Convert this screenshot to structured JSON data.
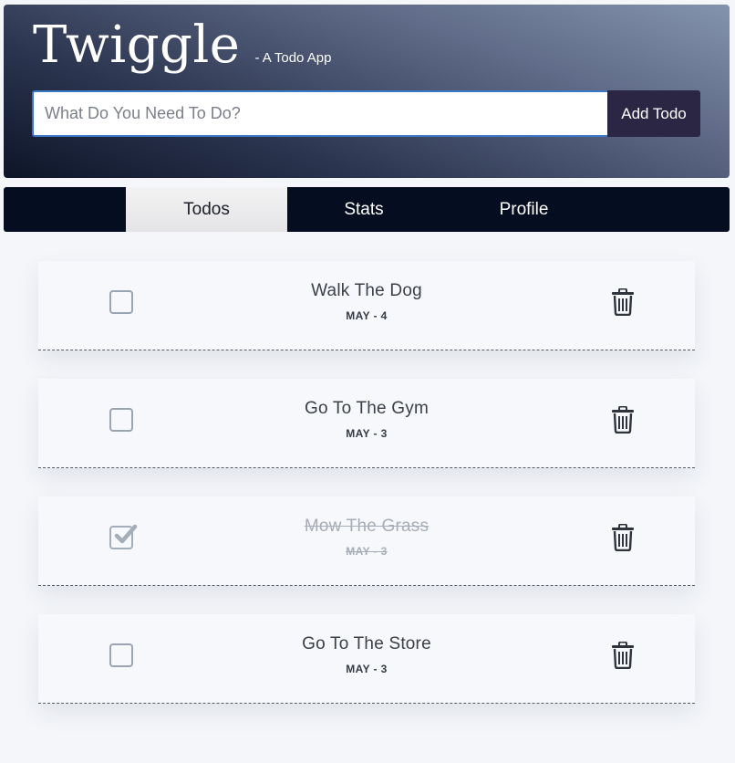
{
  "app": {
    "title": "Twiggle",
    "subtitle": "- A Todo App"
  },
  "add_form": {
    "input_placeholder": "What Do You Need To Do?",
    "input_value": "",
    "button_label": "Add Todo"
  },
  "tabs": [
    {
      "label": "Todos",
      "active": true
    },
    {
      "label": "Stats",
      "active": false
    },
    {
      "label": "Profile",
      "active": false
    }
  ],
  "todos": [
    {
      "title": "Walk The Dog",
      "date": "MAY - 4",
      "completed": false
    },
    {
      "title": "Go To The Gym",
      "date": "MAY - 3",
      "completed": false
    },
    {
      "title": "Mow The Grass",
      "date": "MAY - 3",
      "completed": true
    },
    {
      "title": "Go To The Store",
      "date": "MAY - 3",
      "completed": false
    }
  ],
  "colors": {
    "header_gradient_light": "#8493ad",
    "header_gradient_dark": "#0d1528",
    "nav_background": "#040e20",
    "add_button": "#2a2644",
    "input_focus_border": "#3b78c6",
    "page_background": "#f4f6fa"
  },
  "icons": {
    "delete": "trash-icon",
    "checked": "checkmark-icon"
  }
}
